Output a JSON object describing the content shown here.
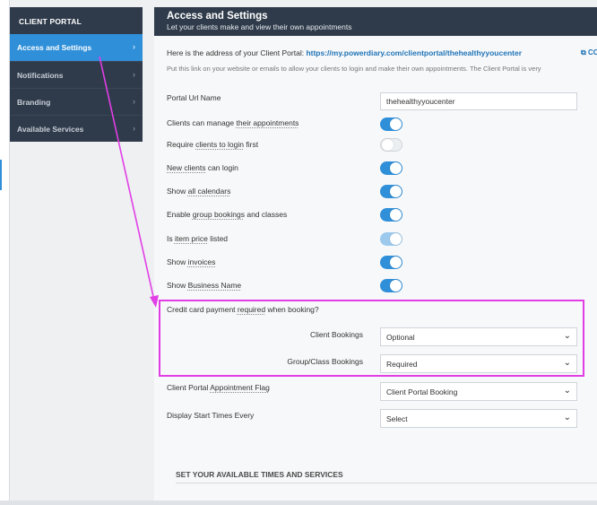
{
  "sidebar": {
    "header": "CLIENT PORTAL",
    "items": [
      {
        "label": "Access and Settings",
        "active": true
      },
      {
        "label": "Notifications",
        "active": false
      },
      {
        "label": "Branding",
        "active": false
      },
      {
        "label": "Available Services",
        "active": false
      }
    ]
  },
  "header": {
    "title": "Access and Settings",
    "subtitle": "Let your clients make and view their own appointments"
  },
  "portal": {
    "prefix": "Here is the address of your Client Portal: ",
    "url": "https://my.powerdiary.com/clientportal/thehealthyyoucenter",
    "copy_label": "CO",
    "hint": "Put this link on your website or emails to allow your clients to login and make their own appointments. The Client Portal is very"
  },
  "settings": {
    "portal_url_label": "Portal Url Name",
    "portal_url_value": "thehealthyyoucenter",
    "manage_appts": {
      "pre": "Clients can manage ",
      "u": "their appointments",
      "state": "on"
    },
    "require_login": {
      "pre": "Require ",
      "u": "clients to login",
      "post": " first",
      "state": "off"
    },
    "new_clients": {
      "u": "New clients",
      "post": " can login",
      "state": "on"
    },
    "show_calendars": {
      "pre": "Show ",
      "u": "all calendars",
      "state": "on"
    },
    "group_bookings": {
      "pre": "Enable ",
      "u": "group bookings",
      "post": " and classes",
      "state": "on"
    },
    "item_price": {
      "pre": "Is ",
      "u": "item price",
      "post": " listed",
      "state": "on-disabled"
    },
    "show_invoices": {
      "pre": "Show ",
      "u": "invoices",
      "state": "on"
    },
    "show_business": {
      "pre": "Show ",
      "u": "Business Name",
      "state": "on"
    }
  },
  "credit_card": {
    "question_pre": "Credit card payment ",
    "question_u": "required",
    "question_post": " when booking?",
    "client_bookings_label": "Client Bookings",
    "client_bookings_value": "Optional",
    "group_bookings_label": "Group/Class Bookings",
    "group_bookings_value": "Required"
  },
  "flag": {
    "label_pre": "Client Portal ",
    "label_u": "Appointment Flag",
    "value": "Client Portal Booking"
  },
  "start_times": {
    "label": "Display Start Times Every",
    "value": "Select"
  },
  "section": {
    "title": "SET YOUR AVAILABLE TIMES AND SERVICES"
  },
  "colors": {
    "nav_dark": "#2f3b4a",
    "accent": "#2f8fd8",
    "annotation": "#e23ee6"
  },
  "icons": {
    "chevron_right": "›",
    "chevron_down": "⌄",
    "copy": "⧉"
  }
}
